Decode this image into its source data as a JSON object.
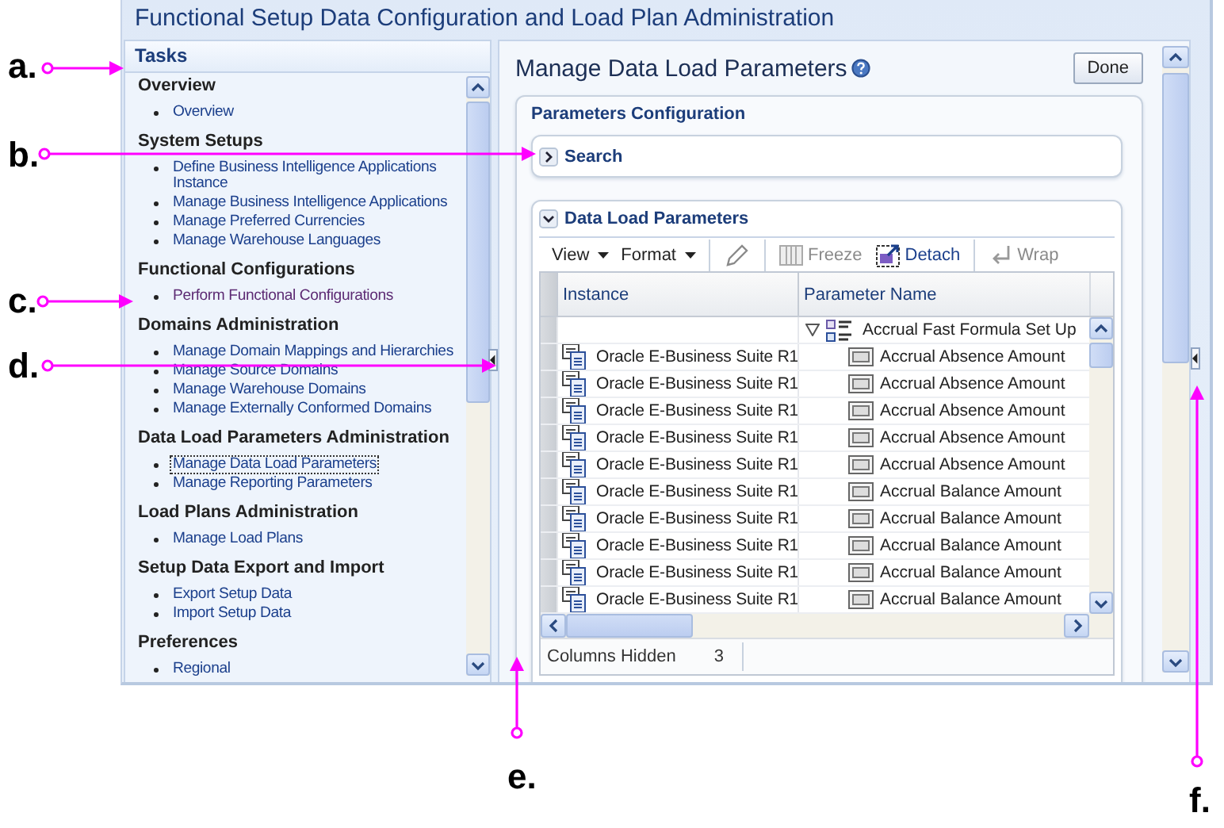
{
  "window": {
    "title": "Functional Setup Data Configuration and Load Plan Administration"
  },
  "tasks": {
    "title": "Tasks",
    "sections": [
      {
        "heading": "Overview",
        "items": [
          {
            "label": "Overview",
            "visited": false,
            "selected": false
          }
        ]
      },
      {
        "heading": "System Setups",
        "items": [
          {
            "label": "Define Business Intelligence Applications Instance",
            "visited": false,
            "selected": false
          },
          {
            "label": "Manage Business Intelligence Applications",
            "visited": false,
            "selected": false
          },
          {
            "label": "Manage Preferred Currencies",
            "visited": false,
            "selected": false
          },
          {
            "label": "Manage Warehouse Languages",
            "visited": false,
            "selected": false
          }
        ]
      },
      {
        "heading": "Functional Configurations",
        "items": [
          {
            "label": "Perform Functional Configurations",
            "visited": true,
            "selected": false
          }
        ]
      },
      {
        "heading": "Domains Administration",
        "items": [
          {
            "label": "Manage Domain Mappings and Hierarchies",
            "visited": false,
            "selected": false
          },
          {
            "label": "Manage Source Domains",
            "visited": false,
            "selected": false
          },
          {
            "label": "Manage Warehouse Domains",
            "visited": false,
            "selected": false
          },
          {
            "label": "Manage Externally Conformed Domains",
            "visited": false,
            "selected": false
          }
        ]
      },
      {
        "heading": "Data Load Parameters Administration",
        "items": [
          {
            "label": "Manage Data Load Parameters",
            "visited": false,
            "selected": true
          },
          {
            "label": "Manage Reporting Parameters",
            "visited": false,
            "selected": false
          }
        ]
      },
      {
        "heading": "Load Plans Administration",
        "items": [
          {
            "label": "Manage Load Plans",
            "visited": false,
            "selected": false
          }
        ]
      },
      {
        "heading": "Setup Data Export and Import",
        "items": [
          {
            "label": "Export Setup Data",
            "visited": false,
            "selected": false
          },
          {
            "label": "Import Setup Data",
            "visited": false,
            "selected": false
          }
        ]
      },
      {
        "heading": "Preferences",
        "items": [
          {
            "label": "Regional",
            "visited": false,
            "selected": false
          }
        ]
      }
    ]
  },
  "main": {
    "title": "Manage Data Load Parameters",
    "done_button": "Done",
    "panel": {
      "title": "Parameters Configuration",
      "search": {
        "label": "Search",
        "expanded": false
      },
      "data_load": {
        "title": "Data Load Parameters",
        "expanded": true,
        "toolbar": [
          {
            "kind": "menu",
            "label": "View",
            "disabled": false
          },
          {
            "kind": "menu",
            "label": "Format",
            "disabled": false
          },
          {
            "kind": "separator"
          },
          {
            "kind": "edit",
            "disabled": true
          },
          {
            "kind": "separator"
          },
          {
            "kind": "freeze",
            "label": "Freeze",
            "disabled": true
          },
          {
            "kind": "detach",
            "label": "Detach",
            "disabled": false
          },
          {
            "kind": "separator"
          },
          {
            "kind": "wrap",
            "label": "Wrap",
            "disabled": true
          }
        ],
        "table": {
          "columns": [
            "Instance",
            "Parameter Name"
          ],
          "rows": [
            {
              "kind": "group",
              "parameter": "Accrual Fast Formula Set Up",
              "expanded": true
            },
            {
              "kind": "param",
              "instance": "Oracle E-Business Suite R1",
              "parameter": "Accrual Absence Amount"
            },
            {
              "kind": "param",
              "instance": "Oracle E-Business Suite R1",
              "parameter": "Accrual Absence Amount"
            },
            {
              "kind": "param",
              "instance": "Oracle E-Business Suite R1",
              "parameter": "Accrual Absence Amount"
            },
            {
              "kind": "param",
              "instance": "Oracle E-Business Suite R1",
              "parameter": "Accrual Absence Amount"
            },
            {
              "kind": "param",
              "instance": "Oracle E-Business Suite R1",
              "parameter": "Accrual Absence Amount"
            },
            {
              "kind": "param",
              "instance": "Oracle E-Business Suite R1",
              "parameter": "Accrual Balance Amount"
            },
            {
              "kind": "param",
              "instance": "Oracle E-Business Suite R1",
              "parameter": "Accrual Balance Amount"
            },
            {
              "kind": "param",
              "instance": "Oracle E-Business Suite R1",
              "parameter": "Accrual Balance Amount"
            },
            {
              "kind": "param",
              "instance": "Oracle E-Business Suite R1",
              "parameter": "Accrual Balance Amount"
            },
            {
              "kind": "param",
              "instance": "Oracle E-Business Suite R1",
              "parameter": "Accrual Balance Amount"
            }
          ],
          "footer": {
            "label": "Columns Hidden",
            "value": "3"
          }
        }
      }
    }
  },
  "callouts": [
    {
      "label": "a."
    },
    {
      "label": "b."
    },
    {
      "label": "c."
    },
    {
      "label": "d."
    },
    {
      "label": "e."
    },
    {
      "label": "f."
    }
  ]
}
